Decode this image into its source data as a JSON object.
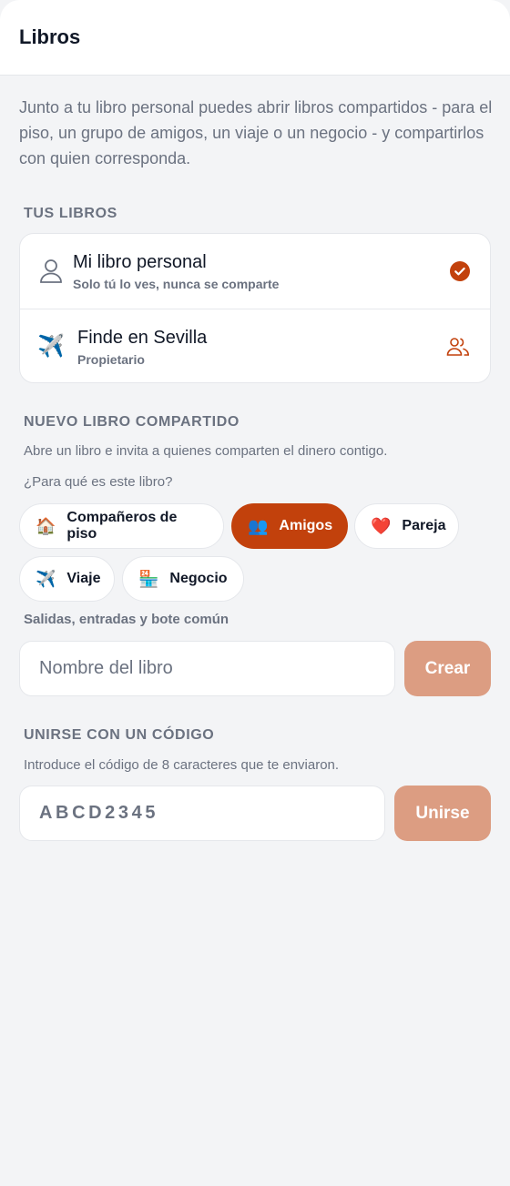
{
  "header": {
    "title": "Libros"
  },
  "intro": "Junto a tu libro personal puedes abrir libros compartidos - para el piso, un grupo de amigos, un viaje o un negocio - y compartirlos con quien corresponda.",
  "books_section": {
    "title": "TUS LIBROS",
    "books": [
      {
        "name": "Mi libro personal",
        "subtitle": "Solo tú lo ves, nunca se comparte",
        "icon": "user-icon",
        "status_icon": "check-circle-icon"
      },
      {
        "name": "Finde en Sevilla",
        "subtitle": "Propietario",
        "icon": "✈️",
        "status_icon": "users-icon"
      }
    ]
  },
  "new_book": {
    "title": "NUEVO LIBRO COMPARTIDO",
    "description": "Abre un libro e invita a quienes comparten el dinero contigo.",
    "question": "¿Para qué es este libro?",
    "types": [
      {
        "emoji": "🏠",
        "label": "Compañeros de piso",
        "selected": false
      },
      {
        "emoji": "👥",
        "label": "Amigos",
        "selected": true
      },
      {
        "emoji": "❤️",
        "label": "Pareja",
        "selected": false
      },
      {
        "emoji": "✈️",
        "label": "Viaje",
        "selected": false
      },
      {
        "emoji": "🏪",
        "label": "Negocio",
        "selected": false
      }
    ],
    "type_hint": "Salidas, entradas y bote común",
    "name_placeholder": "Nombre del libro",
    "create_label": "Crear"
  },
  "join": {
    "title": "UNIRSE CON UN CÓDIGO",
    "description": "Introduce el código de 8 caracteres que te enviaron.",
    "code_placeholder": "ABCD2345",
    "join_label": "Unirse"
  },
  "colors": {
    "accent": "#c2410c",
    "button_disabled": "#dc9d82",
    "background": "#f3f4f6"
  }
}
